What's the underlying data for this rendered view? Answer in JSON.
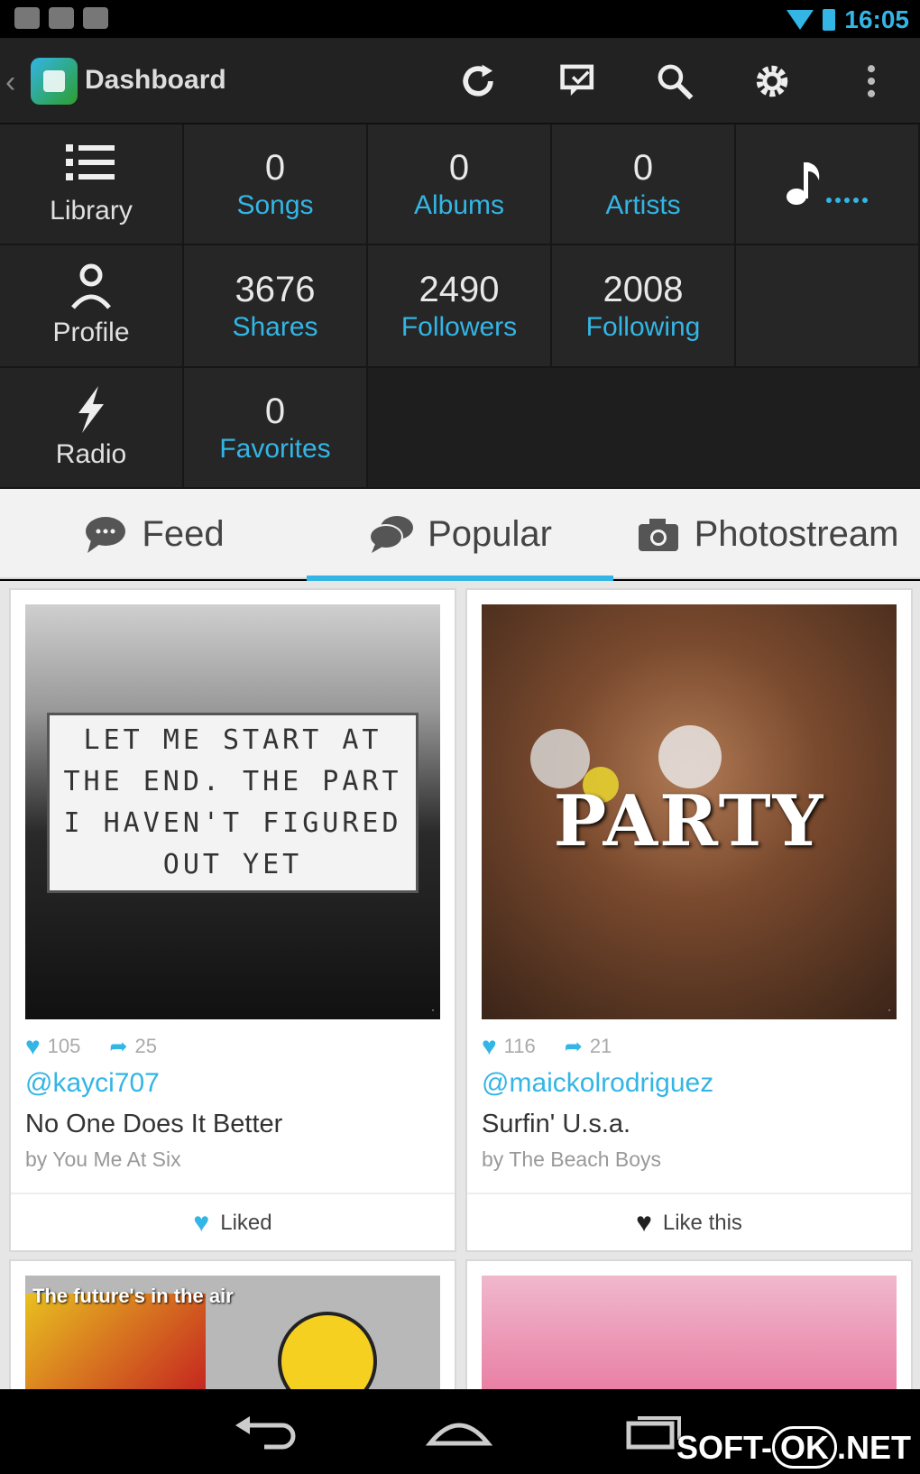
{
  "status_bar": {
    "time": "16:05"
  },
  "action_bar": {
    "title": "Dashboard",
    "icons": [
      "refresh-icon",
      "chat-icon",
      "search-icon",
      "gear-icon",
      "overflow-icon"
    ]
  },
  "dashboard": {
    "nav": [
      {
        "label": "Library",
        "icon": "list-icon"
      },
      {
        "label": "Profile",
        "icon": "person-icon"
      },
      {
        "label": "Radio",
        "icon": "lightning-icon"
      }
    ],
    "stats_row1": [
      {
        "value": "0",
        "label": "Songs"
      },
      {
        "value": "0",
        "label": "Albums"
      },
      {
        "value": "0",
        "label": "Artists"
      }
    ],
    "stats_row2": [
      {
        "value": "3676",
        "label": "Shares"
      },
      {
        "value": "2490",
        "label": "Followers"
      },
      {
        "value": "2008",
        "label": "Following"
      }
    ],
    "stats_row3": [
      {
        "value": "0",
        "label": "Favorites"
      }
    ],
    "now_playing_icon": "music-note-icon"
  },
  "tabs": [
    {
      "label": "Feed",
      "icon": "speech-bubble-icon",
      "active": false
    },
    {
      "label": "Popular",
      "icon": "chat-bubbles-icon",
      "active": true
    },
    {
      "label": "Photostream",
      "icon": "camera-icon",
      "active": false
    }
  ],
  "cards": [
    {
      "image_text": "LET ME START AT THE END. THE PART I HAVEN'T FIGURED OUT YET",
      "likes": "105",
      "shares": "25",
      "user": "@kayci707",
      "song": "No One Does It Better",
      "artist": "by You Me At Six",
      "action": "Liked",
      "action_color": "#33b5e5"
    },
    {
      "image_text": "PARTY",
      "likes": "116",
      "shares": "21",
      "user": "@maickolrodriguez",
      "song": "Surfin' U.s.a.",
      "artist": "by The Beach Boys",
      "action": "Like this",
      "action_color": "#222222"
    }
  ],
  "partial_cards": [
    {
      "caption": "The future's in the air"
    },
    {
      "caption": ""
    }
  ],
  "watermark": {
    "left": "SOFT-",
    "ok": "OK",
    "right": ".NET"
  },
  "colors": {
    "accent": "#33b5e5",
    "dark_bg": "#222222"
  }
}
